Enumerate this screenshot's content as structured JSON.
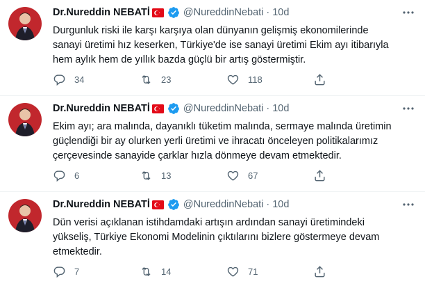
{
  "tweets": [
    {
      "name": "Dr.Nureddin NEBATİ",
      "handle": "@NureddinNebati",
      "separator": "·",
      "time": "10d",
      "text": "Durgunluk riski ile karşı karşıya olan dünyanın gelişmiş ekonomilerinde\nsanayi üretimi hız keserken, Türkiye'de ise sanayi üretimi Ekim ayı itibarıyla\nhem aylık hem de yıllık bazda güçlü bir artış göstermiştir.",
      "replies": "34",
      "retweets": "23",
      "likes": "118"
    },
    {
      "name": "Dr.Nureddin NEBATİ",
      "handle": "@NureddinNebati",
      "separator": "·",
      "time": "10d",
      "text": "Ekim ayı; ara malında, dayanıklı tüketim malında, sermaye malında üretimin\ngüçlendiği bir ay olurken yerli üretimi ve ihracatı önceleyen politikalarımız\nçerçevesinde sanayide çarklar hızla dönmeye devam etmektedir.",
      "replies": "6",
      "retweets": "13",
      "likes": "67"
    },
    {
      "name": "Dr.Nureddin NEBATİ",
      "handle": "@NureddinNebati",
      "separator": "·",
      "time": "10d",
      "text": "Dün verisi açıklanan istihdamdaki artışın ardından sanayi üretimindeki\nyükseliş, Türkiye Ekonomi Modelinin çıktılarını bizlere göstermeye devam\netmektedir.",
      "replies": "7",
      "retweets": "14",
      "likes": "71"
    }
  ],
  "icons": {
    "verified": "verified-badge-icon",
    "flag": "turkey-flag-icon",
    "more": "more-dots-icon",
    "reply": "reply-icon",
    "retweet": "retweet-icon",
    "like": "heart-icon",
    "share": "share-icon"
  },
  "colors": {
    "verified": "#1d9bf0",
    "flag": "#e30a17",
    "meta": "#536471"
  }
}
